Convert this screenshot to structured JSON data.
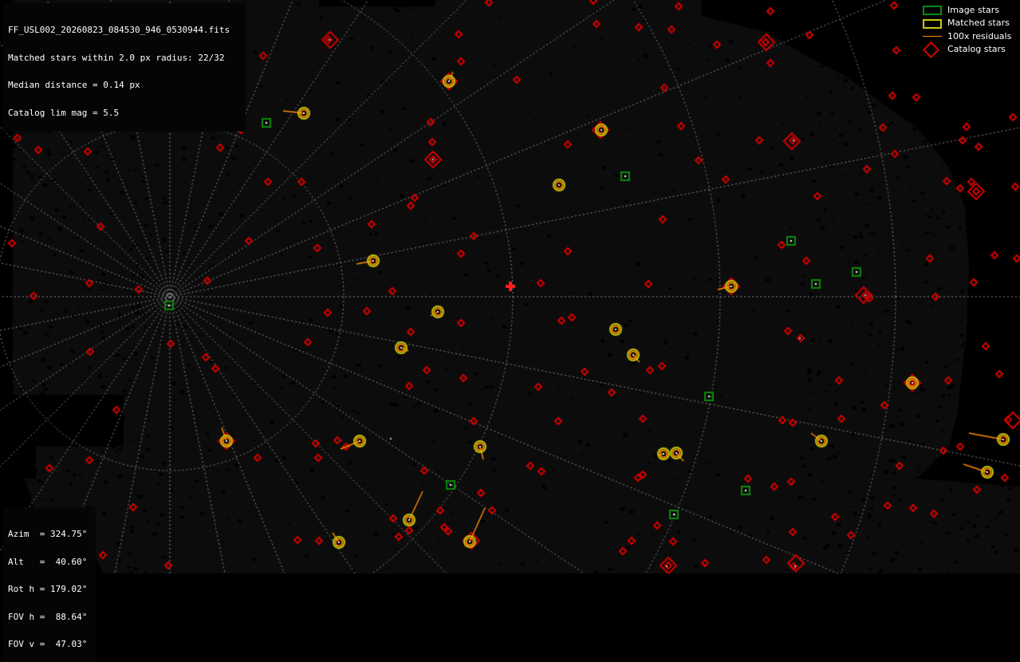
{
  "header": {
    "filename": "FF_USL002_20260823_084530_946_0530944.fits",
    "matched": "Matched stars within 2.0 px radius: 22/32",
    "median": "Median distance = 0.14 px",
    "limmag": "Catalog lim mag = 5.5"
  },
  "pointing": {
    "azim": "Azim  = 324.75°",
    "alt": "Alt   =  40.60°",
    "rot": "Rot h = 179.02°",
    "fovh": "FOV h =  88.64°",
    "fovv": "FOV v =  47.03°"
  },
  "legend": {
    "items": [
      {
        "label": "Image stars",
        "color": "#0b8a0b",
        "icon": "green-square-icon"
      },
      {
        "label": "Matched stars",
        "color": "#c8c80a",
        "icon": "yellow-square-icon"
      },
      {
        "label": "100x residuals",
        "color": "#ff8c00",
        "icon": "orange-line-icon"
      },
      {
        "label": "Catalog stars",
        "color": "#d40000",
        "icon": "red-diamond-icon"
      }
    ]
  },
  "colors": {
    "background": "#000000",
    "sky": "#0c0c0c",
    "grid": "#8a8a8a",
    "catalog": "#d40000",
    "image": "#0b8a0b",
    "matched_outer": "#c8c80a",
    "matched_inner": "#ff8c00",
    "residual": "#ff8c00",
    "center": "#ff1a1a"
  }
}
